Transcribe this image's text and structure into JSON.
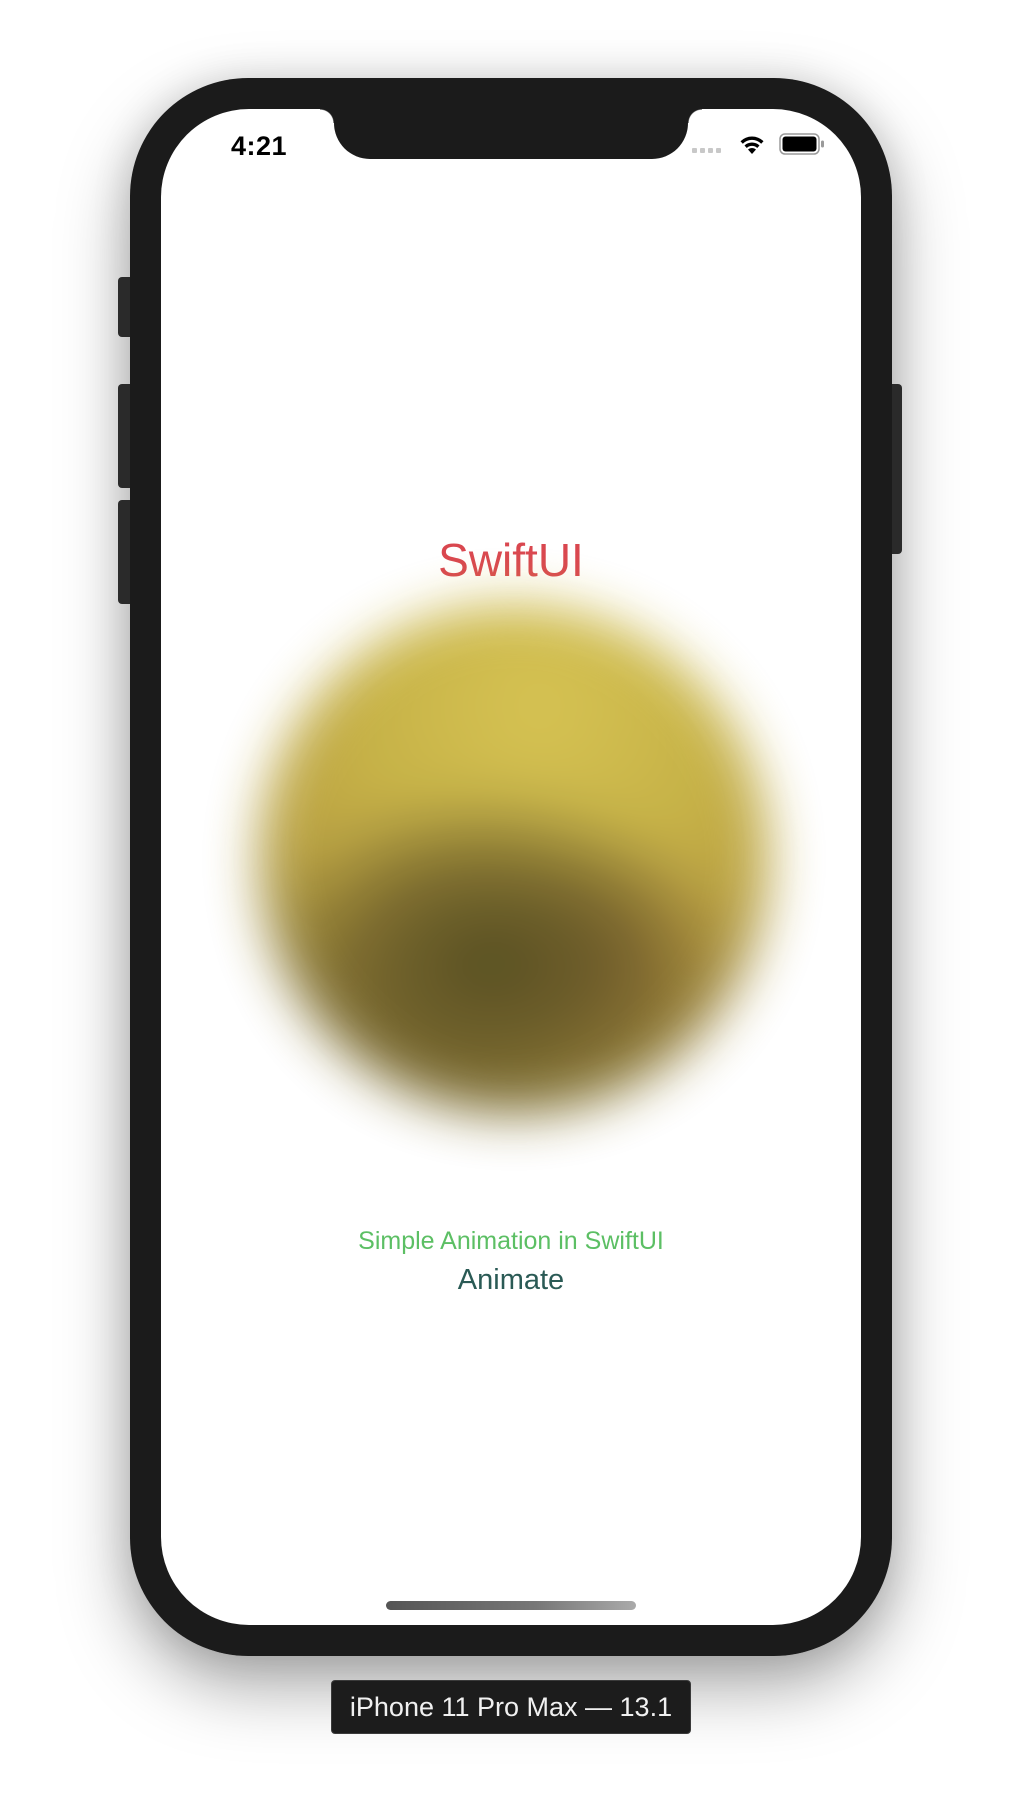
{
  "status_bar": {
    "time": "4:21",
    "signal_icon": "cellular-signal-dots",
    "wifi_icon": "wifi-icon",
    "battery_icon": "battery-icon"
  },
  "content": {
    "title": "SwiftUI",
    "subtitle": "Simple Animation in SwiftUI",
    "button_label": "Animate"
  },
  "simulator": {
    "device_label": "iPhone 11 Pro Max — 13.1"
  },
  "colors": {
    "title": "#d9474f",
    "subtitle": "#5cbf64",
    "button": "#2a5a55",
    "orb_primary": "#c7b240",
    "orb_shadow": "#464014",
    "frame": "#1b1b1b"
  }
}
